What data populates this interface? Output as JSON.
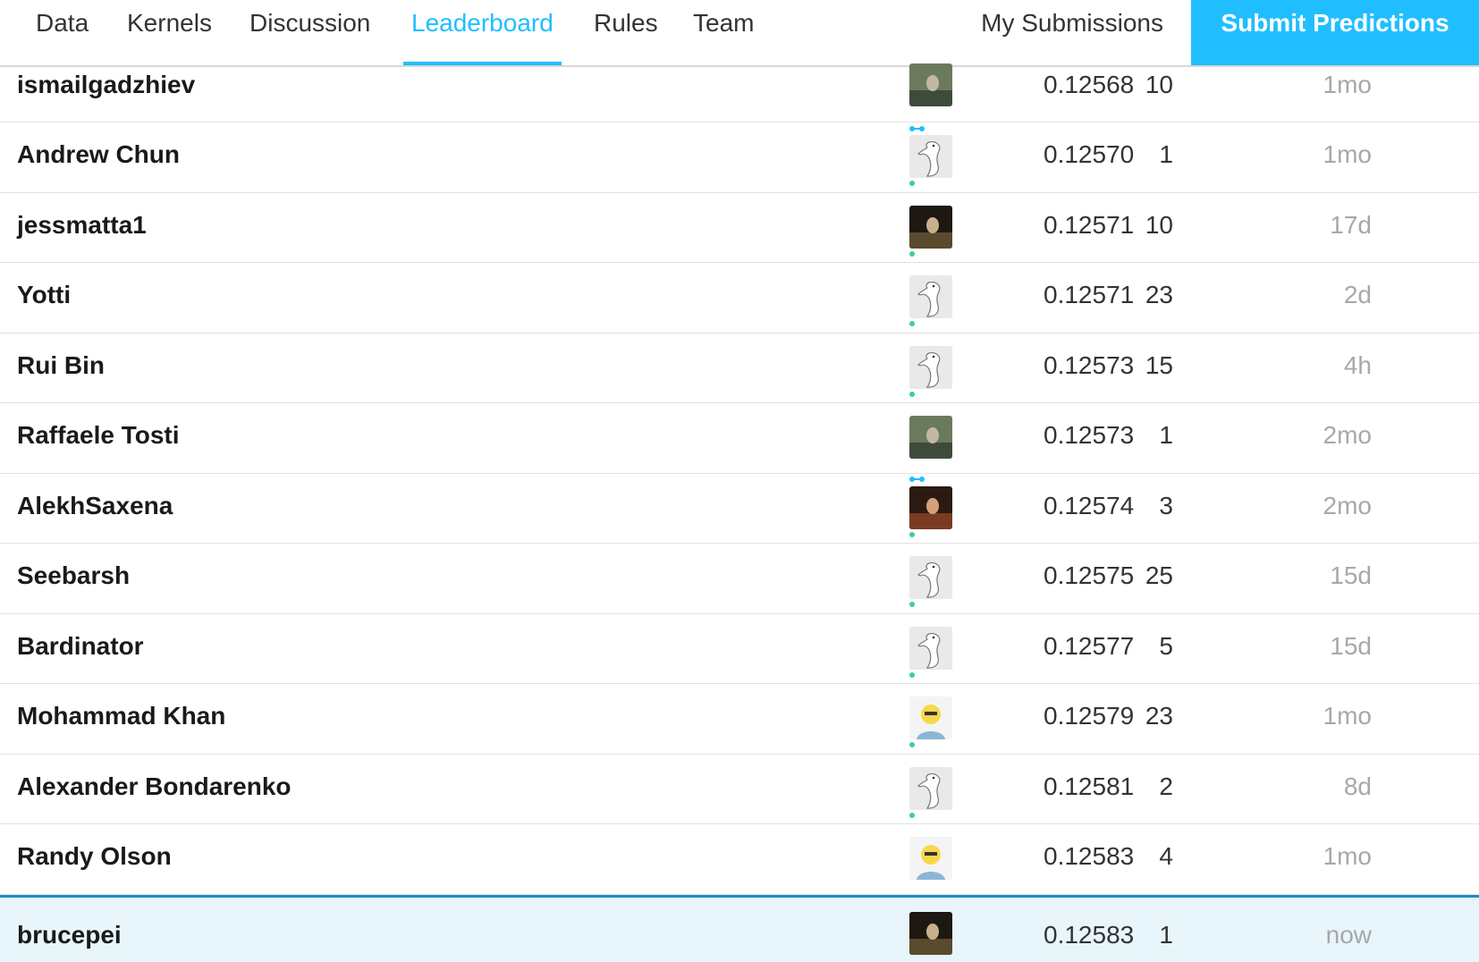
{
  "nav": {
    "tabs": [
      {
        "label": "Data"
      },
      {
        "label": "Kernels"
      },
      {
        "label": "Discussion"
      },
      {
        "label": "Leaderboard",
        "active": true
      },
      {
        "label": "Rules"
      },
      {
        "label": "Team"
      }
    ],
    "my_submissions": "My Submissions",
    "submit_button": "Submit Predictions"
  },
  "colors": {
    "accent": "#20beff",
    "highlight_row_bg": "#e8f6fc",
    "highlight_row_border": "#1e8cc8",
    "tier_novice": "#3ccf9a",
    "tier_contributor": "#20beff"
  },
  "leaderboard": {
    "rows": [
      {
        "team": "ismailgadzhiev",
        "avatar": "photo-avatar",
        "tier": "contributor",
        "score": "0.12568",
        "entries": "10",
        "last": "1mo"
      },
      {
        "team": "Andrew Chun",
        "avatar": "default-goose-avatar",
        "tier": "novice",
        "score": "0.12570",
        "entries": "1",
        "last": "1mo"
      },
      {
        "team": "jessmatta1",
        "avatar": "photo-avatar",
        "tier": "novice",
        "score": "0.12571",
        "entries": "10",
        "last": "17d"
      },
      {
        "team": "Yotti",
        "avatar": "default-goose-avatar",
        "tier": "novice",
        "score": "0.12571",
        "entries": "23",
        "last": "2d"
      },
      {
        "team": "Rui Bin",
        "avatar": "default-goose-avatar",
        "tier": "novice",
        "score": "0.12573",
        "entries": "15",
        "last": "4h"
      },
      {
        "team": "Raffaele Tosti",
        "avatar": "photo-avatar",
        "tier": "contributor",
        "score": "0.12573",
        "entries": "1",
        "last": "2mo"
      },
      {
        "team": "AlekhSaxena",
        "avatar": "photo-avatar",
        "tier": "novice",
        "score": "0.12574",
        "entries": "3",
        "last": "2mo"
      },
      {
        "team": "Seebarsh",
        "avatar": "default-goose-avatar",
        "tier": "novice",
        "score": "0.12575",
        "entries": "25",
        "last": "15d"
      },
      {
        "team": "Bardinator",
        "avatar": "default-goose-avatar",
        "tier": "novice",
        "score": "0.12577",
        "entries": "5",
        "last": "15d"
      },
      {
        "team": "Mohammad Khan",
        "avatar": "cartoon-avatar",
        "tier": "novice",
        "score": "0.12579",
        "entries": "23",
        "last": "1mo"
      },
      {
        "team": "Alexander Bondarenko",
        "avatar": "default-goose-avatar",
        "tier": "novice",
        "score": "0.12581",
        "entries": "2",
        "last": "8d"
      },
      {
        "team": "Randy Olson",
        "avatar": "cartoon-avatar",
        "tier": "contributor",
        "score": "0.12583",
        "entries": "4",
        "last": "1mo"
      }
    ],
    "current_user": {
      "team": "brucepei",
      "avatar": "photo-avatar",
      "score": "0.12583",
      "entries": "1",
      "last": "now"
    }
  }
}
